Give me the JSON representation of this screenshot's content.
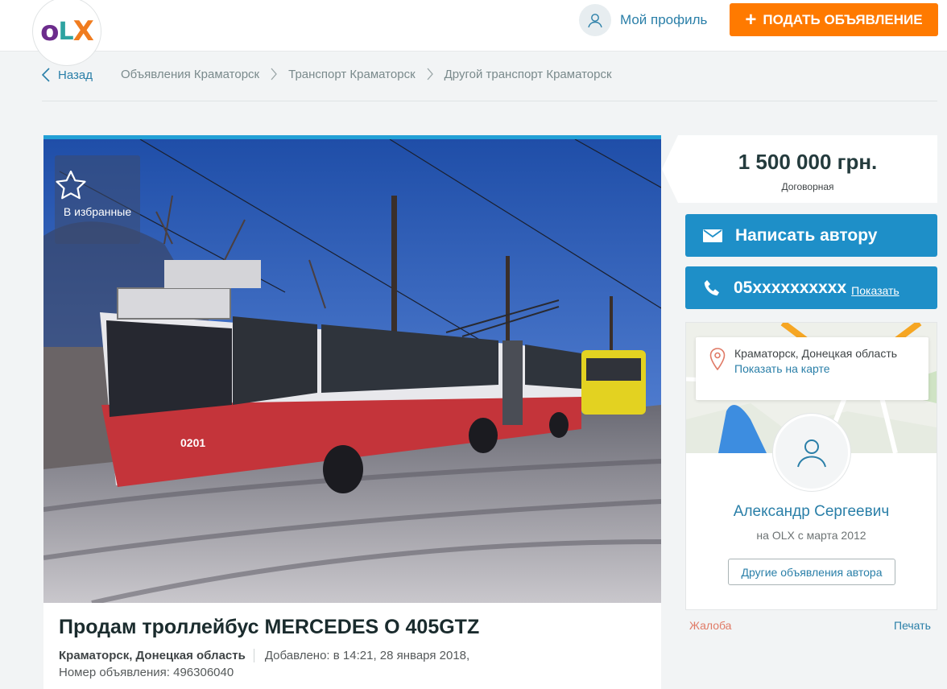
{
  "header": {
    "logo_text": "OLX",
    "profile_label": "Мой профиль",
    "post_ad_label": "ПОДАТЬ ОБЪЯВЛЕНИЕ"
  },
  "breadcrumb": {
    "back_label": "Назад",
    "items": [
      "Объявления Краматорск",
      "Транспорт Краматорск",
      "Другой транспорт Краматорск"
    ]
  },
  "gallery": {
    "favorite_label": "В избранные",
    "bus_number": "0201"
  },
  "listing": {
    "title": "Продам троллейбус MERCEDES O 405GTZ",
    "location": "Краматорск, Донецкая область",
    "added": "Добавлено: в 14:21, 28 января 2018,",
    "ad_number": "Номер объявления: 496306040"
  },
  "price": {
    "amount": "1 500 000 грн.",
    "note": "Договорная"
  },
  "contact": {
    "message_label": "Написать автору",
    "phone_masked": "05xxxxxxxxxx",
    "show_label": "Показать"
  },
  "seller": {
    "location": "Краматорск, Донецкая область",
    "show_on_map": "Показать на карте",
    "name": "Александр Сергеевич",
    "since": "на OLX с марта 2012",
    "other_ads_label": "Другие объявления автора"
  },
  "footer_links": {
    "complaint": "Жалоба",
    "print": "Печать"
  },
  "colors": {
    "accent_orange": "#ff7a00",
    "accent_blue": "#1e8fc8",
    "link_blue": "#2a7fa8"
  }
}
